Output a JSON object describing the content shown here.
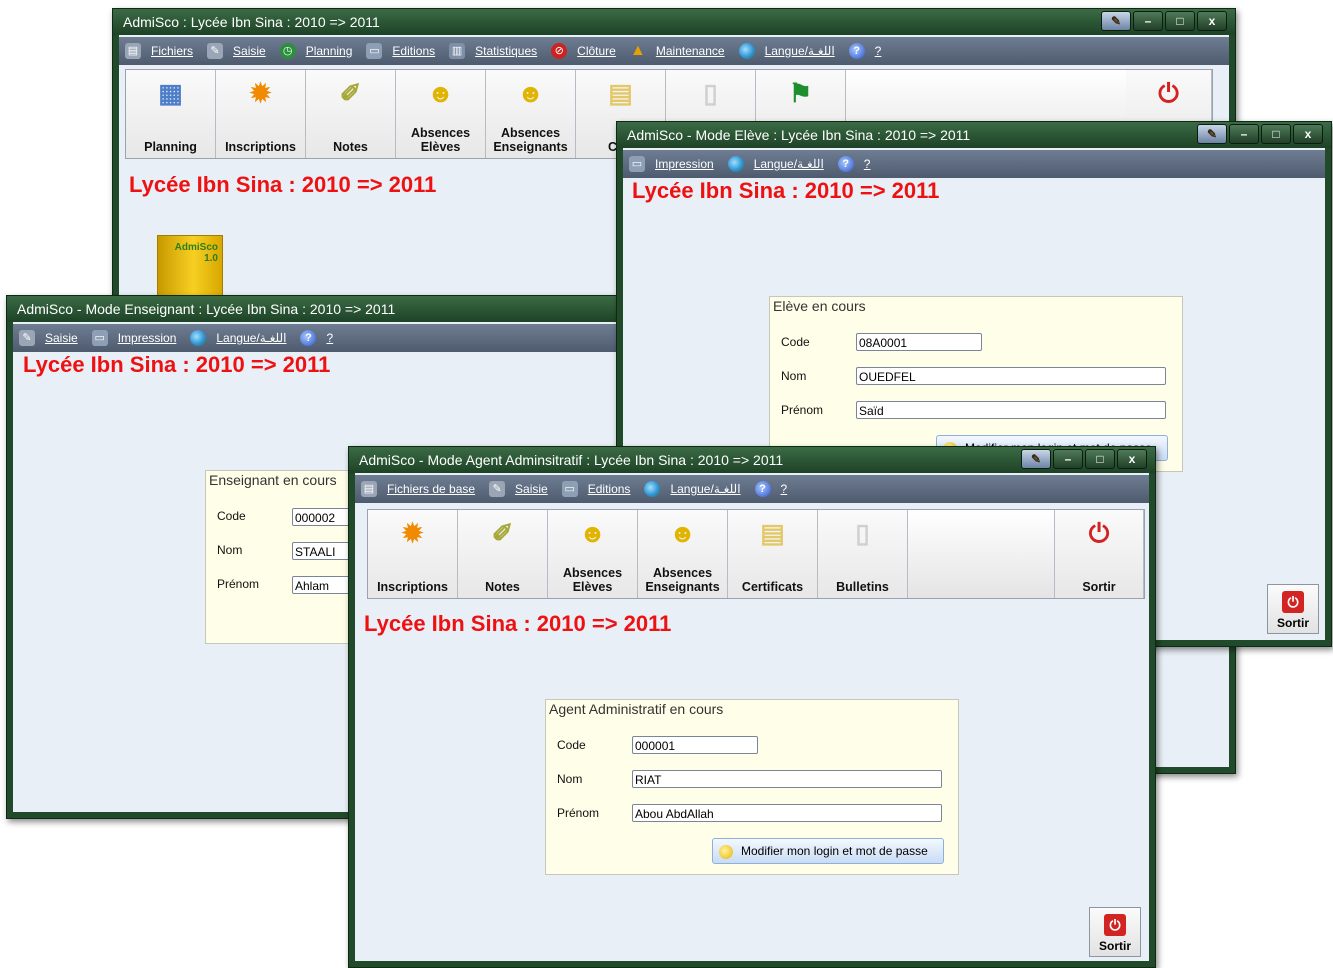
{
  "school_heading": "Lycée Ibn Sina : 2010 => 2011",
  "window_controls": {
    "minimize": "–",
    "maximize": "□",
    "close": "x"
  },
  "main_window": {
    "title": "AdmiSco : Lycée Ibn Sina : 2010 => 2011",
    "menu": [
      "Fichiers",
      "Saisie",
      "Planning",
      "Editions",
      "Statistiques",
      "Clôture",
      "Maintenance",
      "Langue/اللغـة",
      "?"
    ],
    "toolbar": [
      "Planning",
      "Inscriptions",
      "Notes",
      "Absences Elèves",
      "Absences Enseignants",
      "Cert"
    ],
    "logo_text": "AdmiSco 1.0"
  },
  "teacher_window": {
    "title": "AdmiSco - Mode Enseignant : Lycée Ibn Sina : 2010 => 2011",
    "menu": [
      "Saisie",
      "Impression",
      "Langue/اللغـة",
      "?"
    ],
    "panel": {
      "title": "Enseignant en cours",
      "code_label": "Code",
      "code": "000002",
      "nom_label": "Nom",
      "nom": "STAALI",
      "prenom_label": "Prénom",
      "prenom": "Ahlam"
    }
  },
  "student_window": {
    "title": "AdmiSco - Mode Elève : Lycée Ibn Sina : 2010 => 2011",
    "menu": [
      "Impression",
      "Langue/اللغـة",
      "?"
    ],
    "panel": {
      "title": "Elève en cours",
      "code_label": "Code",
      "code": "08A0001",
      "nom_label": "Nom",
      "nom": "OUEDFEL",
      "prenom_label": "Prénom",
      "prenom": "Saïd",
      "button": "Modifier mon login et mot de passe"
    },
    "exit": "Sortir"
  },
  "agent_window": {
    "title": "AdmiSco - Mode Agent Adminsitratif : Lycée Ibn Sina : 2010 => 2011",
    "menu": [
      "Fichiers de base",
      "Saisie",
      "Editions",
      "Langue/اللغـة",
      "?"
    ],
    "toolbar": [
      "Inscriptions",
      "Notes",
      "Absences Elèves",
      "Absences Enseignants",
      "Certificats",
      "Bulletins",
      "Sortir"
    ],
    "panel": {
      "title": "Agent Administratif en cours",
      "code_label": "Code",
      "code": "000001",
      "nom_label": "Nom",
      "nom": "RIAT",
      "prenom_label": "Prénom",
      "prenom": "Abou AbdAllah",
      "button": "Modifier mon login et mot de passe"
    },
    "exit": "Sortir"
  },
  "icons": [
    "book-icon",
    "pen-icon",
    "clock-icon",
    "print-icon",
    "chart-icon",
    "stop-icon",
    "warning-icon",
    "globe-icon",
    "help-icon",
    "power-icon",
    "brush-icon"
  ],
  "colors": {
    "title_green": "#214a2a",
    "heading_red": "#ee1111",
    "client_bg": "#e9eff6",
    "panel_bg": "#fffee8",
    "menubar": "#5e6b80"
  }
}
